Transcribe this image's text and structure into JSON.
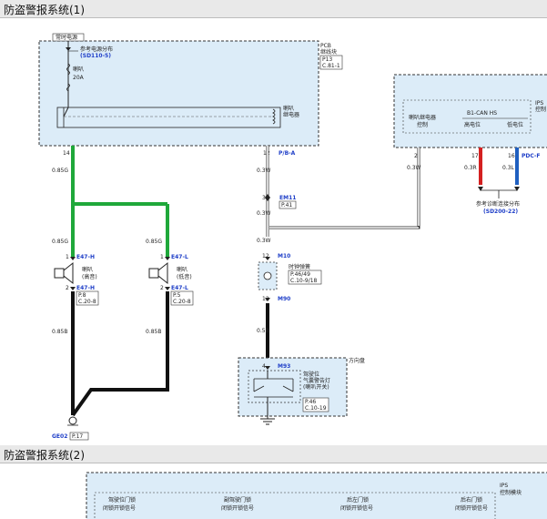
{
  "section1": {
    "title": "防盗警报系统(1)"
  },
  "section2": {
    "title": "防盗警报系统(2)"
  },
  "pcb": {
    "label_line1": "PCB",
    "label_line2": "继线块",
    "page": "P13",
    "ref": "C.81-1",
    "constant_power": "常时电源",
    "power_dist_line1": "参考电源分布",
    "power_dist_ref": "(SD110-5)",
    "fuse_name": "喇叭",
    "fuse_rating": "20A",
    "relay_line1": "喇叭",
    "relay_line2": "继电器",
    "pin_left": "14",
    "pin_right": "12",
    "connector_right": "P/B-A"
  },
  "ips": {
    "label_line1": "IPS",
    "label_line2": "控制",
    "relay_ctrl_line1": "喇叭继电器",
    "relay_ctrl_line2": "控制",
    "can_label": "B1-CAN HS",
    "can_high": "高电位",
    "can_low": "低电位",
    "pin_a": "2",
    "pin_b": "17",
    "pin_c": "16",
    "connector_c": "PDC-F",
    "wire_a": "0.3W",
    "wire_b": "0.3R",
    "wire_c": "0.3L",
    "diag_ref_line1": "参考诊断连接分布",
    "diag_ref_line2": "(SD200-22)"
  },
  "horn_high": {
    "pin_top": "1",
    "pin_bottom": "2",
    "connector": "E47-H",
    "name_line1": "喇叭",
    "name_line2": "(高音)",
    "page": "P.8",
    "ref": "C.20-8"
  },
  "horn_low": {
    "pin_top": "1",
    "pin_bottom": "2",
    "connector": "E47-L",
    "name_line1": "喇叭",
    "name_line2": "(低音)",
    "page": "P.5",
    "ref": "C.20-8"
  },
  "wires": {
    "w_085g_top": "0.85G",
    "w_085g_left": "0.85G",
    "w_085g_right": "0.85G",
    "w_085b_left": "0.85B",
    "w_085b_right": "0.85B",
    "w_03w_1": "0.3W",
    "w_03w_2": "0.3W",
    "w_03w_3": "0.3W",
    "w_05b": "0.5B"
  },
  "em11": {
    "pin": "35",
    "connector": "EM11",
    "page": "P.41"
  },
  "m10": {
    "pin_top": "12",
    "connector": "M10",
    "pin_bottom": "12",
    "connector_bottom": "M90"
  },
  "clock_spring": {
    "name": "时钟弹簧",
    "page": "P.46/49",
    "ref": "C.10-9/18"
  },
  "steering": {
    "title": "方向盘",
    "pin": "4",
    "connector": "M93",
    "name_line1": "驾驶位",
    "name_line2": "气囊警告灯",
    "name_line3": "(喇叭开关)",
    "page": "P.46",
    "ref": "C.10-19"
  },
  "ground": {
    "name": "GE02",
    "page": "P.17"
  },
  "section2_box": {
    "ips_line1": "IPS",
    "ips_line2": "控制模块",
    "col1_line1": "驾驶位门锁",
    "col1_line2": "闭锁开锁信号",
    "col2_line1": "副驾驶门锁",
    "col2_line2": "闭锁开锁信号",
    "col3_line1": "后左门锁",
    "col3_line2": "闭锁开锁信号",
    "col4_line1": "后右门锁",
    "col4_line2": "闭锁开锁信号"
  },
  "colors": {
    "green_wire": "#1fa83a",
    "black_wire": "#111111",
    "red_wire": "#d42020",
    "blue_wire": "#1f5fc0",
    "module_fill": "#dcecf8",
    "connector_text": "#1f3fc8"
  }
}
